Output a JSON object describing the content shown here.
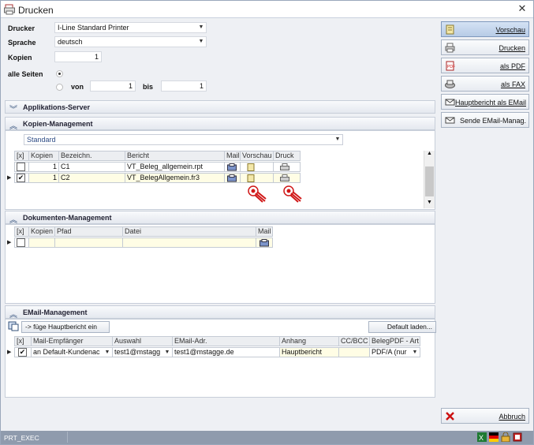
{
  "window": {
    "title": "Drucken"
  },
  "form": {
    "printer_label": "Drucker",
    "printer_value": "I-Line Standard Printer",
    "language_label": "Sprache",
    "language_value": "deutsch",
    "copies_label": "Kopien",
    "copies_value": "1",
    "all_pages_label": "alle Seiten",
    "from_label": "von",
    "from_value": "1",
    "to_label": "bis",
    "to_value": "1"
  },
  "buttons": {
    "preview": "Vorschau",
    "print": "Drucken",
    "as_pdf": "als PDF",
    "as_fax": "als FAX",
    "main_report_email": "Hauptbericht als EMail",
    "send_email": "Sende EMail-Manag.",
    "cancel": "Abbruch"
  },
  "app_server": {
    "title": "Applikations-Server"
  },
  "copies_mgmt": {
    "title": "Kopien-Management",
    "profile": "Standard",
    "headers": [
      "[x]",
      "Kopien",
      "Bezeichn.",
      "Bericht",
      "Mail",
      "Vorschau",
      "Druck"
    ],
    "rows": [
      {
        "checked": false,
        "copies": "1",
        "name": "C1",
        "report": "VT_Beleg_allgemein.rpt"
      },
      {
        "checked": true,
        "copies": "1",
        "name": "C2",
        "report": "VT_BelegAllgemein.fr3"
      }
    ]
  },
  "docs_mgmt": {
    "title": "Dokumenten-Management",
    "headers": [
      "[x]",
      "Kopien",
      "Pfad",
      "Datei",
      "Mail"
    ]
  },
  "email_mgmt": {
    "title": "EMail-Management",
    "add_main_report": "-> füge Hauptbericht ein",
    "load_default": "Default laden...",
    "headers": [
      "[x]",
      "Mail-Empfänger",
      "Auswahl",
      "EMail-Adr.",
      "Anhang",
      "CC/BCC",
      "BelegPDF - Art"
    ],
    "row": {
      "recipient": "an Default-Kundenac",
      "selection": "test1@mstagg",
      "address": "test1@mstagge.de",
      "attachment": "Hauptbericht",
      "cc": "",
      "pdf_type": "PDF/A (nur"
    }
  },
  "status": {
    "text": "PRT_EXEC"
  },
  "colors": {
    "accent": "#b7cbe6",
    "status_bar": "#8f9bad",
    "highlight_row": "#fffde5",
    "cursor_red": "#d01818"
  }
}
